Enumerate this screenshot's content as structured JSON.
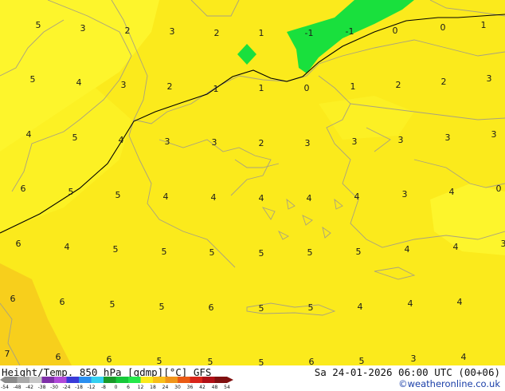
{
  "map": {
    "colors": {
      "yellow_main": "#fbea1c",
      "yellow_light": "#fdf52c",
      "yellow_orange": "#f7cf1c",
      "green": "#19e03d",
      "border": "#a9a27f",
      "contour": "#000000"
    },
    "temperature_labels": [
      "5",
      "3",
      "2",
      "3",
      "2",
      "1",
      "-1",
      "-1",
      "0",
      "0",
      "1",
      "5",
      "4",
      "3",
      "2",
      "1",
      "1",
      "0",
      "1",
      "2",
      "2",
      "3",
      "4",
      "5",
      "4",
      "3",
      "3",
      "2",
      "3",
      "3",
      "3",
      "3",
      "3",
      "6",
      "5",
      "5",
      "4",
      "4",
      "4",
      "4",
      "4",
      "3",
      "4",
      "0",
      "6",
      "4",
      "5",
      "5",
      "5",
      "5",
      "5",
      "5",
      "4",
      "4",
      "3",
      "6",
      "6",
      "5",
      "5",
      "6",
      "5",
      "5",
      "4",
      "4",
      "4",
      "7",
      "6",
      "6",
      "5",
      "5",
      "5",
      "6",
      "5",
      "3",
      "4"
    ]
  },
  "footer": {
    "title": "Height/Temp. 850 hPa [gdmp][°C] GFS",
    "datetime": "Sa 24-01-2026 06:00 UTC (00+06)",
    "credit": "©weatheronline.co.uk"
  },
  "legend": {
    "ticks": [
      "-54",
      "-48",
      "-42",
      "-38",
      "-30",
      "-24",
      "-18",
      "-12",
      "-8",
      "0",
      "6",
      "12",
      "18",
      "24",
      "30",
      "36",
      "42",
      "48",
      "54"
    ],
    "colors": [
      "#8a8a8a",
      "#a9a9a9",
      "#c8c8c8",
      "#7f2fa8",
      "#b048d8",
      "#3a3ad8",
      "#2a8ff0",
      "#34d0f0",
      "#1a9a2a",
      "#17c83a",
      "#25e84a",
      "#fbea1c",
      "#f8c01a",
      "#f0951a",
      "#ea5a14",
      "#d8251a",
      "#b01016",
      "#801010"
    ]
  }
}
